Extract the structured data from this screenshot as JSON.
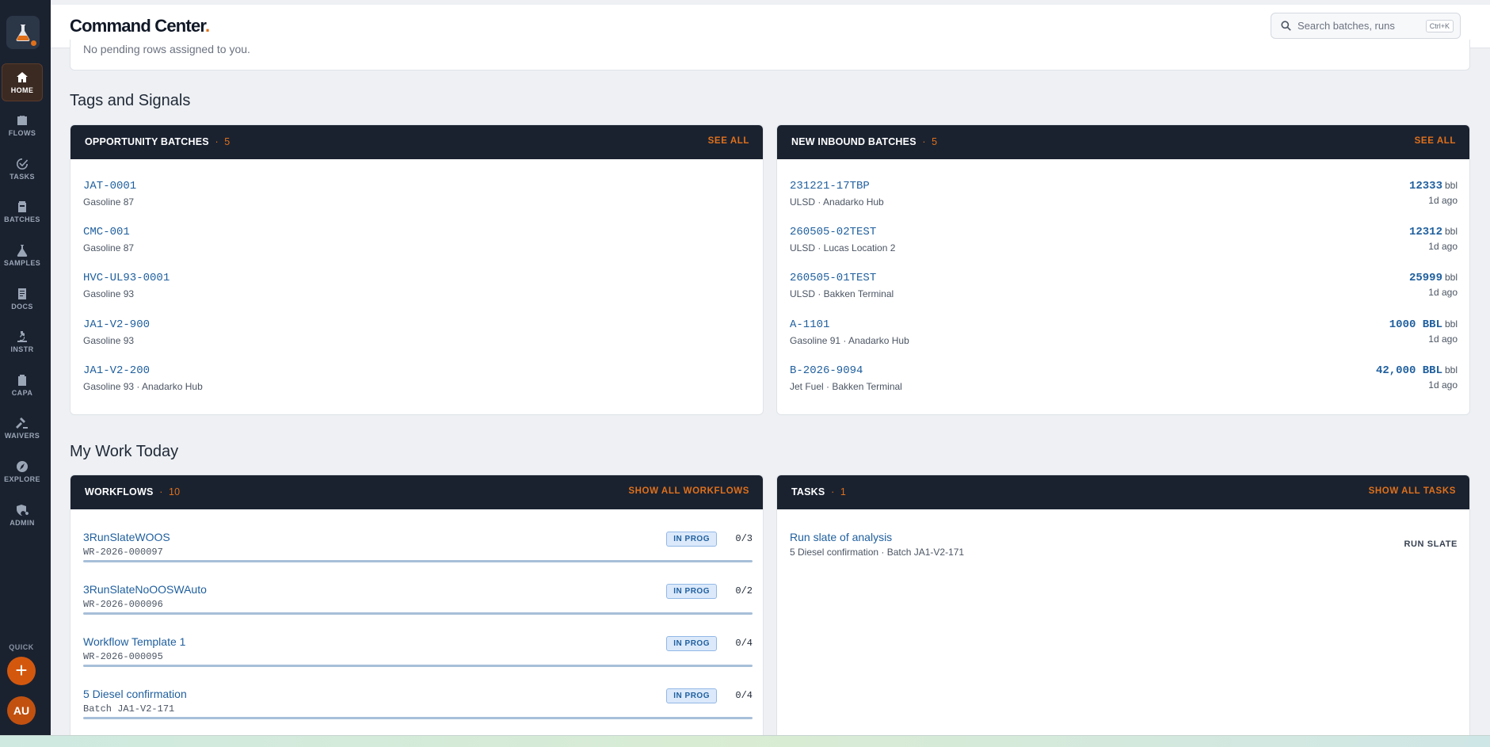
{
  "app": {
    "brand": "Command Center",
    "brand_dot": "."
  },
  "search": {
    "placeholder": "Search batches, runs",
    "shortcut": "Ctrl+K"
  },
  "sidebar": {
    "items": [
      {
        "label": "HOME",
        "icon": "home-icon",
        "active": true
      },
      {
        "label": "FLOWS",
        "icon": "briefcase-icon"
      },
      {
        "label": "TASKS",
        "icon": "check-circle-icon"
      },
      {
        "label": "BATCHES",
        "icon": "drum-icon"
      },
      {
        "label": "SAMPLES",
        "icon": "flask-icon"
      },
      {
        "label": "DOCS",
        "icon": "document-icon"
      },
      {
        "label": "INSTR",
        "icon": "microscope-icon"
      },
      {
        "label": "CAPA",
        "icon": "clipboard-check-icon"
      },
      {
        "label": "WAIVERS",
        "icon": "gavel-icon"
      },
      {
        "label": "EXPLORE",
        "icon": "compass-icon"
      },
      {
        "label": "ADMIN",
        "icon": "admin-shield-icon"
      }
    ],
    "quick_label": "QUICK",
    "quick_symbol": "+",
    "avatar_initials": "AU"
  },
  "previous": {
    "text": "No pending rows assigned to you."
  },
  "tags_section": {
    "title": "Tags and Signals"
  },
  "opportunity": {
    "title": "OPPORTUNITY BATCHES",
    "sep": "·",
    "count": "5",
    "action": "SEE ALL",
    "rows": [
      {
        "id": "JAT-0001",
        "sub": "Gasoline 87"
      },
      {
        "id": "CMC-001",
        "sub": "Gasoline 87"
      },
      {
        "id": "HVC-UL93-0001",
        "sub": "Gasoline 93"
      },
      {
        "id": "JA1-V2-900",
        "sub": "Gasoline 93"
      },
      {
        "id": "JA1-V2-200",
        "sub": "Gasoline 93 · Anadarko Hub"
      }
    ]
  },
  "inbound": {
    "title": "NEW INBOUND BATCHES",
    "sep": "·",
    "count": "5",
    "action": "SEE ALL",
    "rows": [
      {
        "id": "231221-17TBP",
        "sub": "ULSD · Anadarko Hub",
        "qty": "12333",
        "unit": "bbl",
        "age": "1d ago"
      },
      {
        "id": "260505-02TEST",
        "sub": "ULSD · Lucas Location 2",
        "qty": "12312",
        "unit": "bbl",
        "age": "1d ago"
      },
      {
        "id": "260505-01TEST",
        "sub": "ULSD · Bakken Terminal",
        "qty": "25999",
        "unit": "bbl",
        "age": "1d ago"
      },
      {
        "id": "A-1101",
        "sub": "Gasoline 91 · Anadarko Hub",
        "qty": "1000 BBL",
        "unit": "bbl",
        "age": "1d ago"
      },
      {
        "id": "B-2026-9094",
        "sub": "Jet Fuel · Bakken Terminal",
        "qty": "42,000 BBL",
        "unit": "bbl",
        "age": "1d ago"
      }
    ]
  },
  "work_section": {
    "title": "My Work Today"
  },
  "workflows": {
    "title": "WORKFLOWS",
    "sep": "·",
    "count": "10",
    "action": "SHOW ALL WORKFLOWS",
    "rows": [
      {
        "name": "3RunSlateWOOS",
        "id": "WR-2026-000097",
        "status": "IN PROG",
        "progress": "0/3",
        "fraction": 0
      },
      {
        "name": "3RunSlateNoOOSWAuto",
        "id": "WR-2026-000096",
        "status": "IN PROG",
        "progress": "0/2",
        "fraction": 0
      },
      {
        "name": "Workflow Template 1",
        "id": "WR-2026-000095",
        "status": "IN PROG",
        "progress": "0/4",
        "fraction": 0
      },
      {
        "name": "5 Diesel confirmation",
        "id": "Batch JA1-V2-171",
        "status": "IN PROG",
        "progress": "0/4",
        "fraction": 0
      }
    ]
  },
  "tasks": {
    "title": "TASKS",
    "sep": "·",
    "count": "1",
    "action": "SHOW ALL TASKS",
    "rows": [
      {
        "name": "Run slate of analysis",
        "sub": "5 Diesel confirmation · Batch JA1-V2-171",
        "action": "RUN SLATE"
      }
    ]
  },
  "colors": {
    "accent": "#e0701a",
    "sidebar": "#1a2230",
    "link": "#1f5f9e",
    "background": "#eef0f3"
  }
}
